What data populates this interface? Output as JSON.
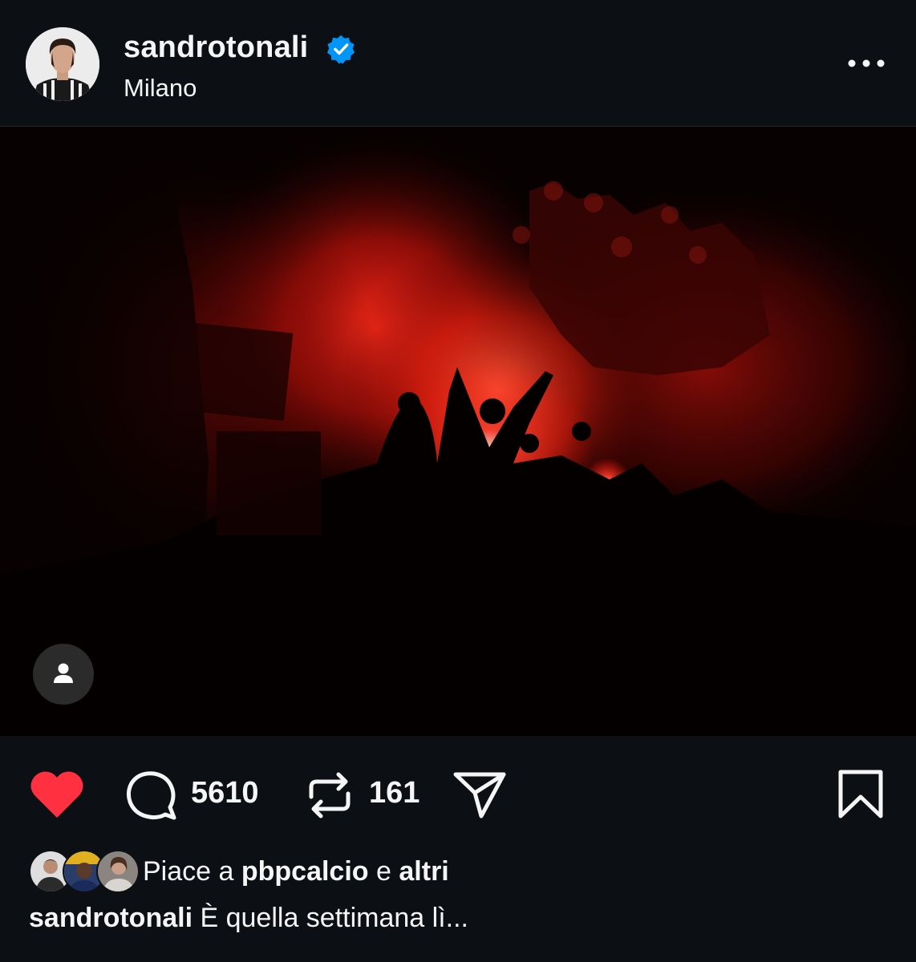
{
  "post": {
    "username": "sandrotonali",
    "location": "Milano",
    "verified_icon": "verified-badge-icon",
    "accent_color": "#0095f6"
  },
  "actions": {
    "like_icon": "heart-filled-icon",
    "like_color": "#ff3040",
    "comment_icon": "comment-bubble-icon",
    "comment_count": "5610",
    "repost_icon": "repost-icon",
    "repost_count": "161",
    "share_icon": "paper-plane-icon",
    "save_icon": "bookmark-icon"
  },
  "likes": {
    "prefix": "Piace a",
    "user": "pbpcalcio",
    "conjunction": "e",
    "others": "altri"
  },
  "caption": {
    "username": "sandrotonali",
    "text": "È quella settimana lì..."
  }
}
